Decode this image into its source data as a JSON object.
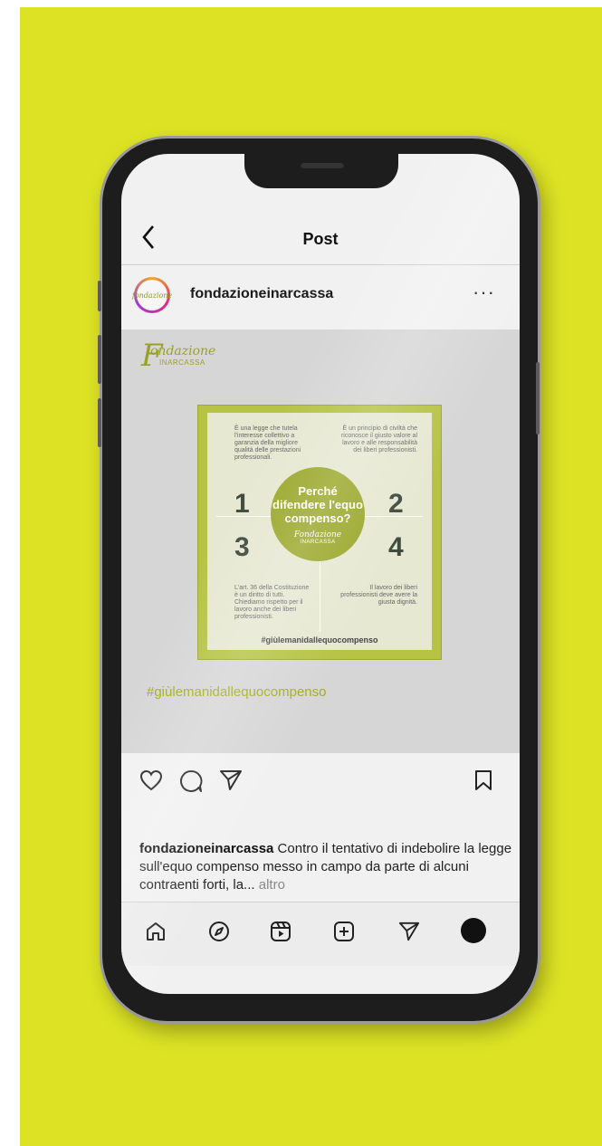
{
  "header": {
    "back_label": "<",
    "title": "Post"
  },
  "user": {
    "username": "fondazioneinarcassa",
    "more_label": "···",
    "avatar_text": "fondazione"
  },
  "post_image": {
    "brand_f": "F",
    "brand_name": "ondazione",
    "brand_sub": "INARCASSA",
    "quadrants": [
      {
        "number": "1",
        "text": "È una legge che tutela l'interesse collettivo a garanzia della migliore qualità delle prestazioni professionali."
      },
      {
        "number": "2",
        "text": "È un principio di civiltà che riconosce il giusto valore al lavoro e alle responsabilità dei liberi professionisti."
      },
      {
        "number": "3",
        "text": "L'art. 36 della Costituzione è un diritto di tutti. Chiediamo rispetto per il lavoro anche dei liberi professionisti."
      },
      {
        "number": "4",
        "text": "Il lavoro dei liberi professionisti deve avere la giusta dignità."
      }
    ],
    "circle_title": "Perché difendere l'equo compenso?",
    "circle_logo": "Fondazione",
    "circle_sub": "INARCASSA",
    "inner_hashtag": "#giùlemanidallequocompenso"
  },
  "post_hashtag": "#giùlemanidallequocompenso",
  "caption": {
    "username": "fondazioneinarcassa",
    "text": " Contro il tentativo di indebolire la legge sull'equo compenso messo in campo da parte di alcuni contraenti forti, la...",
    "more": " altro"
  },
  "icons": {
    "like": "heart-icon",
    "comment": "comment-icon",
    "share": "send-icon",
    "save": "bookmark-icon",
    "home": "home-icon",
    "explore": "compass-icon",
    "reels": "reels-icon",
    "create": "plus-square-icon",
    "direct": "send-icon",
    "profile": "profile-icon"
  },
  "colors": {
    "background": "#dde324",
    "accent": "#9aa82a",
    "hashtag": "#a5ac1f"
  }
}
